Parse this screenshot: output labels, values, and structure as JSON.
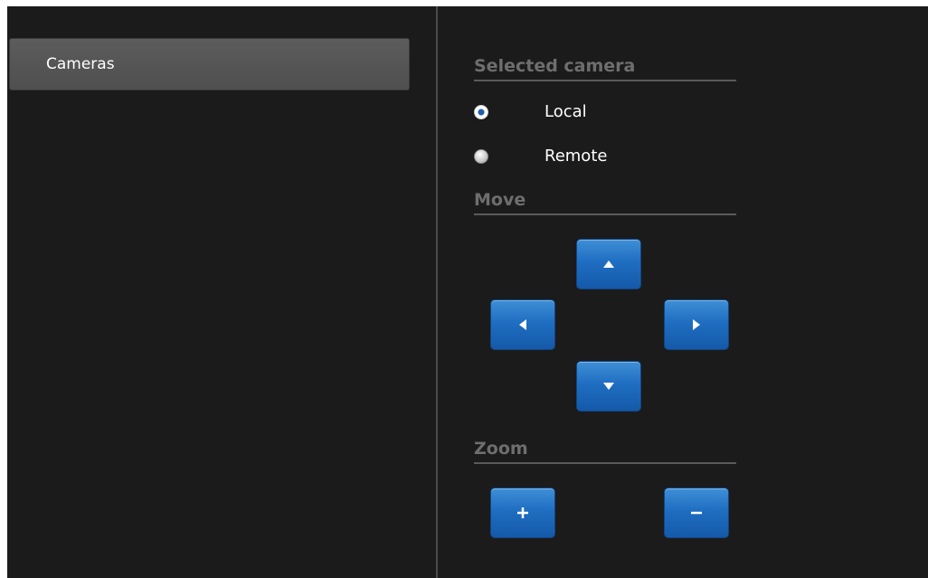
{
  "sidebar": {
    "items": [
      {
        "label": "Cameras",
        "selected": true
      }
    ]
  },
  "panel": {
    "selected_camera": {
      "title": "Selected camera",
      "options": [
        {
          "label": "Local",
          "checked": true
        },
        {
          "label": "Remote",
          "checked": false
        }
      ]
    },
    "move": {
      "title": "Move",
      "buttons": [
        "move-up",
        "move-left",
        "move-right",
        "move-down"
      ]
    },
    "zoom": {
      "title": "Zoom",
      "buttons": [
        "zoom-in",
        "zoom-out"
      ]
    }
  },
  "colors": {
    "background": "#1b1b1b",
    "button_blue": "#1f6ec2",
    "section_title": "#6e6e6e",
    "text": "#ffffff"
  }
}
